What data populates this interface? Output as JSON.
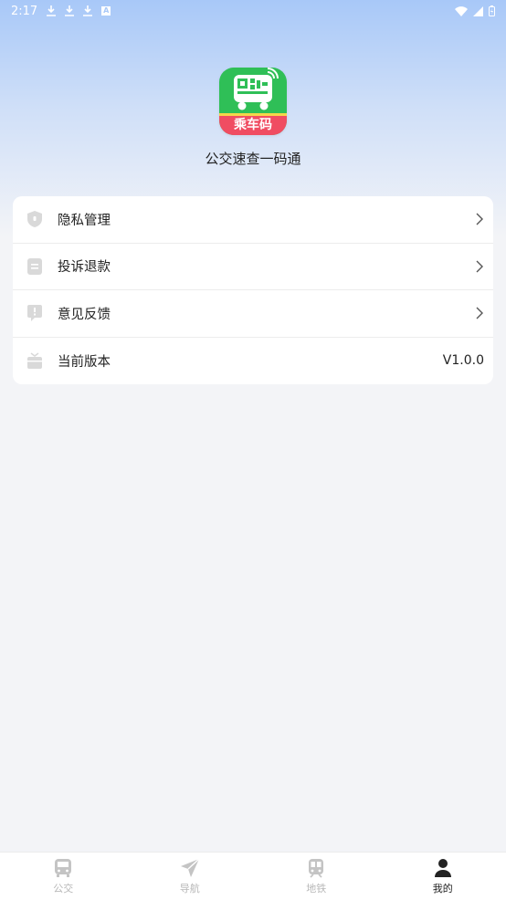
{
  "status_bar": {
    "time": "2:17",
    "notification_icons": [
      "download-icon",
      "download-icon",
      "download-icon",
      "a-icon"
    ],
    "system_icons": [
      "wifi-icon",
      "signal-icon",
      "battery-icon"
    ]
  },
  "header": {
    "logo_label": "乘车码",
    "app_name": "公交速查一码通"
  },
  "menu": {
    "items": [
      {
        "label": "隐私管理",
        "icon": "shield-icon"
      },
      {
        "label": "投诉退款",
        "icon": "document-icon"
      },
      {
        "label": "意见反馈",
        "icon": "feedback-icon"
      },
      {
        "label": "当前版本",
        "icon": "gift-icon",
        "value": "V1.0.0"
      }
    ]
  },
  "bottom_nav": {
    "items": [
      {
        "label": "公交",
        "icon": "bus-icon",
        "active": false
      },
      {
        "label": "导航",
        "icon": "navigation-icon",
        "active": false
      },
      {
        "label": "地铁",
        "icon": "subway-icon",
        "active": false
      },
      {
        "label": "我的",
        "icon": "person-icon",
        "active": true
      }
    ]
  },
  "colors": {
    "logo_green": "#2fbf57",
    "logo_red": "#f04d62",
    "active_tab": "#222222",
    "inactive_tab": "#b8b8b8"
  }
}
